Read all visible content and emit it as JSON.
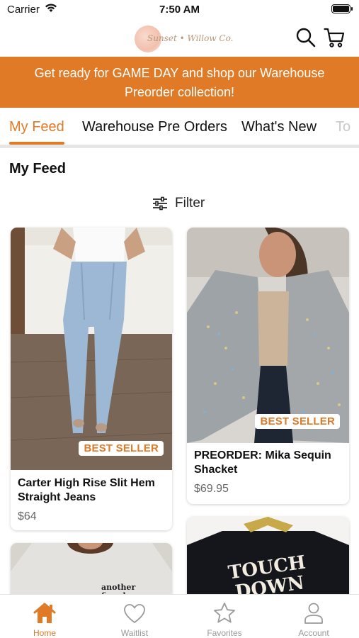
{
  "status_bar": {
    "carrier": "Carrier",
    "time": "7:50 AM"
  },
  "header": {
    "logo_text": "Sunset • Willow Co."
  },
  "banner": {
    "line1": "Get ready for GAME DAY and shop our Warehouse",
    "line2": "Preorder collection!"
  },
  "tabs": [
    {
      "label": "My Feed"
    },
    {
      "label": "Warehouse Pre Orders"
    },
    {
      "label": "What's New"
    },
    {
      "label": "To"
    }
  ],
  "feed": {
    "title": "My Feed",
    "filter_label": "Filter"
  },
  "products": [
    {
      "name_line1": "Carter High Rise Slit Hem",
      "name_line2": "Straight Jeans",
      "price": "$64",
      "badge": "BEST SELLER"
    },
    {
      "name_line1": "PREORDER: Mika Sequin",
      "name_line2": "Shacket",
      "price": "$69.95",
      "badge": "BEST SELLER"
    },
    {
      "print_line1": "another",
      "print_line2": "fine day"
    },
    {
      "print_line1": "TOUCH",
      "print_line2": "DOWN"
    }
  ],
  "tabbar": [
    {
      "label": "Home",
      "icon": "home-icon"
    },
    {
      "label": "Waitlist",
      "icon": "heart-icon"
    },
    {
      "label": "Favorites",
      "icon": "star-icon"
    },
    {
      "label": "Account",
      "icon": "account-icon"
    }
  ],
  "colors": {
    "accent": "#e07a26",
    "inactive": "#999999"
  }
}
